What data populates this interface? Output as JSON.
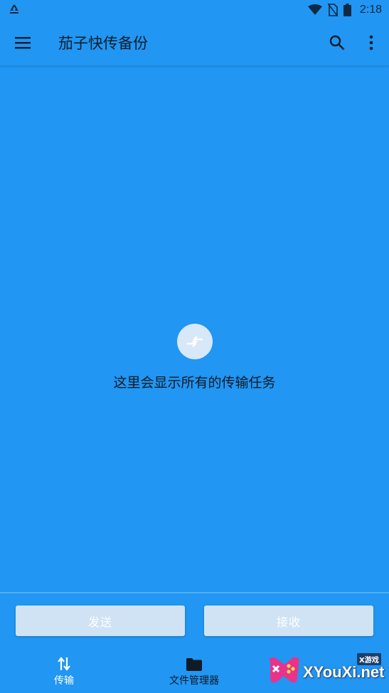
{
  "status_bar": {
    "time": "2:18",
    "icons": [
      "recycle-icon",
      "wifi-icon",
      "no-sim-icon",
      "battery-icon"
    ]
  },
  "app_bar": {
    "title": "茄子快传备份",
    "icons": [
      "menu-icon",
      "search-icon",
      "more-vert-icon"
    ]
  },
  "empty_state": {
    "icon": "swap-arrows-icon",
    "message": "这里会显示所有的传输任务"
  },
  "actions": {
    "send_label": "发送",
    "receive_label": "接收"
  },
  "bottom_nav": {
    "items": [
      {
        "label": "传输",
        "icon": "swap-vert-icon"
      },
      {
        "label": "文件管理器",
        "icon": "folder-icon"
      }
    ]
  },
  "watermark": {
    "text": "XYouXi.net",
    "tag": "X游戏"
  },
  "colors": {
    "primary": "#2196F3",
    "button_bg": "#CFE3F5",
    "text_dark": "#101b26"
  }
}
